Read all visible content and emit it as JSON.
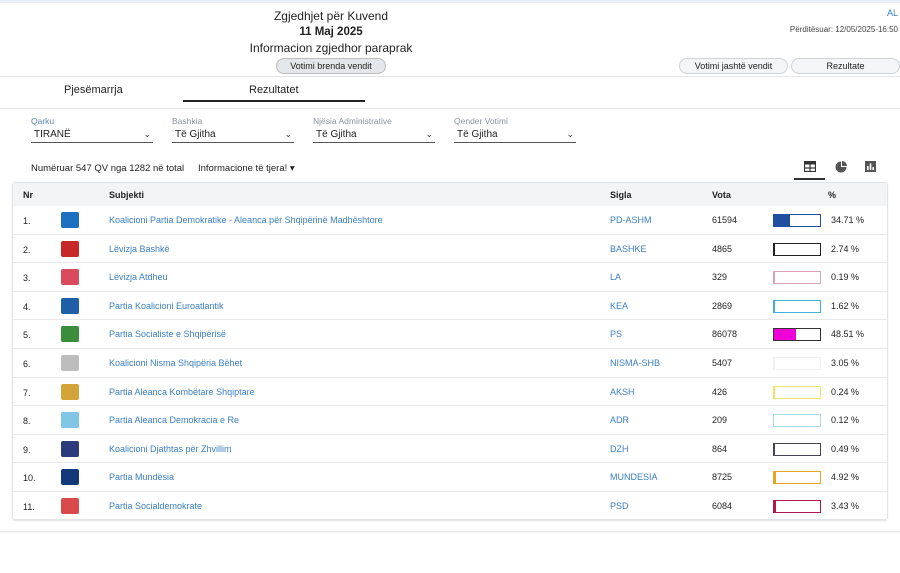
{
  "header": {
    "lang": "AL",
    "updated": "Përditësuar: 12/05/2025-16:50",
    "title": "Zgjedhjet për Kuvend",
    "date": "11 Maj 2025",
    "subtitle": "Informacion zgjedhor paraprak",
    "btn_inside": "Votimi brenda vendit",
    "btn_abroad": "Votimi jashtë vendit",
    "btn_results": "Rezultate"
  },
  "tabs": {
    "participation": "Pjesëmarrja",
    "results": "Rezultatet"
  },
  "filters": {
    "qarku": {
      "label": "Qarku",
      "value": "TIRANË"
    },
    "bashkia": {
      "label": "Bashkia",
      "value": "Të Gjitha"
    },
    "njesia": {
      "label": "Njësia Administrative",
      "value": "Të Gjitha"
    },
    "qender": {
      "label": "Qender Votimi",
      "value": "Të Gjitha"
    }
  },
  "counted": "Numëruar 547 QV nga 1282 në total",
  "more_info": "Informacione të tjera! ▾",
  "table": {
    "headers": {
      "nr": "Nr",
      "subject": "Subjekti",
      "sigla": "Sigla",
      "vota": "Vota",
      "pct": "%"
    },
    "rows": [
      {
        "nr": "1.",
        "subject": "Koalicioni Partia Demokratike - Aleanca për Shqipërinë Madhështore",
        "sigla": "PD-ASHM",
        "vota": "61594",
        "pct": "34.71 %",
        "share": 34.71,
        "color": "#1f4f9e",
        "border": "#1f4f9e",
        "logo": "#1b6fc0"
      },
      {
        "nr": "2.",
        "subject": "Lëvizja Bashkë",
        "sigla": "BASHKE",
        "vota": "4865",
        "pct": "2.74 %",
        "share": 2.74,
        "color": "#222222",
        "border": "#222222",
        "logo": "#c62828"
      },
      {
        "nr": "3.",
        "subject": "Lëvizja Atdheu",
        "sigla": "LA",
        "vota": "329",
        "pct": "0.19 %",
        "share": 0.19,
        "color": "#d8a2b8",
        "border": "#d8a2b8",
        "logo": "#d84a5c"
      },
      {
        "nr": "4.",
        "subject": "Partia Koalicioni Euroatlantik",
        "sigla": "KEA",
        "vota": "2869",
        "pct": "1.62 %",
        "share": 1.62,
        "color": "#3fb1d6",
        "border": "#3fb1d6",
        "logo": "#1e5fa8"
      },
      {
        "nr": "5.",
        "subject": "Partia Socialiste e Shqipërisë",
        "sigla": "PS",
        "vota": "86078",
        "pct": "48.51 %",
        "share": 48.51,
        "color": "#ee00d6",
        "border": "#333333",
        "logo": "#3b8d3b"
      },
      {
        "nr": "6.",
        "subject": "Koalicioni Nisma Shqipëria Bëhet",
        "sigla": "NISMA-SHB",
        "vota": "5407",
        "pct": "3.05 %",
        "share": 3.05,
        "color": "#f0f0f0",
        "border": "#f0f0f0",
        "logo": "#bdbdbd"
      },
      {
        "nr": "7.",
        "subject": "Partia Aleanca Kombëtare Shqiptare",
        "sigla": "AKSH",
        "vota": "426",
        "pct": "0.24 %",
        "share": 0.24,
        "color": "#f2e46a",
        "border": "#f2e46a",
        "logo": "#d4a43a"
      },
      {
        "nr": "8.",
        "subject": "Partia Aleanca Demokracia e Re",
        "sigla": "ADR",
        "vota": "209",
        "pct": "0.12 %",
        "share": 0.12,
        "color": "#a9dbe6",
        "border": "#a9dbe6",
        "logo": "#7fc6e4"
      },
      {
        "nr": "9.",
        "subject": "Koalicioni Djathtas për Zhvillim",
        "sigla": "DZH",
        "vota": "864",
        "pct": "0.49 %",
        "share": 0.49,
        "color": "#444455",
        "border": "#444455",
        "logo": "#2a3a7a"
      },
      {
        "nr": "10.",
        "subject": "Partia Mundësia",
        "sigla": "MUNDESIA",
        "vota": "8725",
        "pct": "4.92 %",
        "share": 4.92,
        "color": "#e8a321",
        "border": "#e8a321",
        "logo": "#123a7a"
      },
      {
        "nr": "11.",
        "subject": "Partia Socialdemokrate",
        "sigla": "PSD",
        "vota": "6084",
        "pct": "3.43 %",
        "share": 3.43,
        "color": "#b01850",
        "border": "#b01850",
        "logo": "#d94a4a"
      }
    ]
  }
}
